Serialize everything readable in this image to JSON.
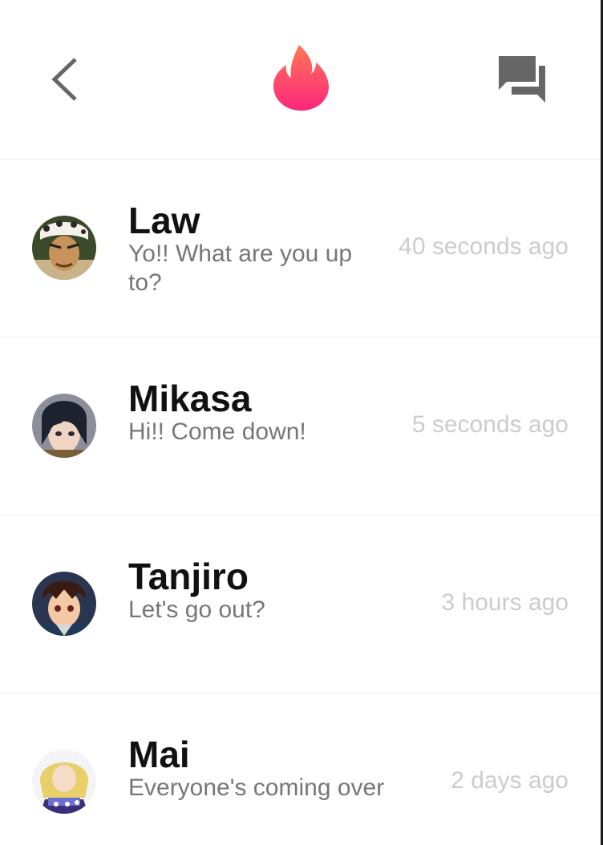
{
  "header": {
    "back_icon": "chevron-left-icon",
    "logo_icon": "flame-logo-icon",
    "chat_icon": "chat-bubbles-icon",
    "brand_gradient": [
      "#ff7854",
      "#fd267d"
    ],
    "icon_color": "#666666"
  },
  "conversations": [
    {
      "name": "Law",
      "message": "Yo!! What are you up to?",
      "time": "40 seconds ago"
    },
    {
      "name": "Mikasa",
      "message": "Hi!! Come down!",
      "time": "5 seconds ago"
    },
    {
      "name": "Tanjiro",
      "message": "Let's go out?",
      "time": "3 hours ago"
    },
    {
      "name": "Mai",
      "message": "Everyone's coming over",
      "time": "2 days ago"
    }
  ]
}
